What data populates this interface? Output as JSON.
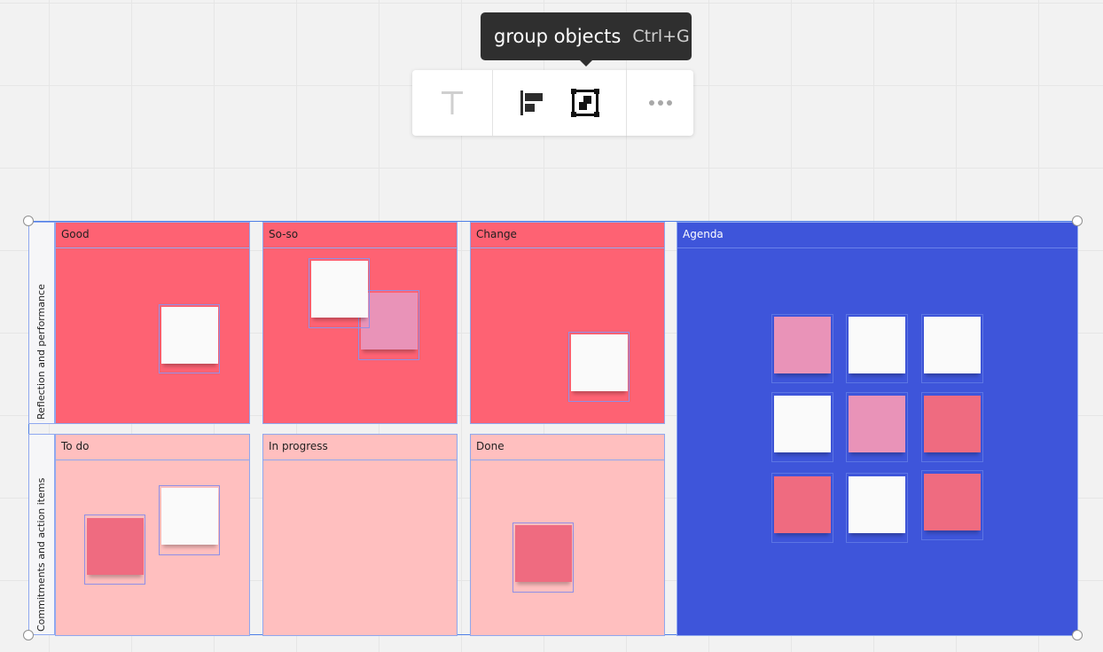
{
  "tooltip": {
    "label": "group objects",
    "shortcut": "Ctrl+G"
  },
  "toolbar": {
    "buttons": [
      {
        "name": "text-format-button",
        "icon": "text-icon"
      },
      {
        "name": "align-button",
        "icon": "align-left-icon"
      },
      {
        "name": "group-objects-button",
        "icon": "group-objects-icon"
      },
      {
        "name": "more-options-button",
        "icon": "more-horizontal-icon"
      }
    ]
  },
  "board": {
    "rows": [
      {
        "label": "Reflection and performance"
      },
      {
        "label": "Commitments and action items"
      }
    ],
    "columns": {
      "good": "Good",
      "soso": "So-so",
      "change": "Change",
      "todo": "To do",
      "inprogress": "In progress",
      "done": "Done",
      "agenda": "Agenda"
    }
  },
  "colors": {
    "accent": "#4f7fe6",
    "reflection_bg": "#fe6273",
    "commitments_bg": "#ffbfbf",
    "agenda_bg": "#3e55da",
    "sticky_white": "#fafafa",
    "sticky_pink": "#e993b8",
    "sticky_red": "#ef6b80"
  }
}
